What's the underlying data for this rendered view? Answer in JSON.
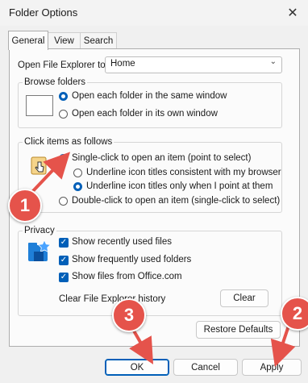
{
  "window": {
    "title": "Folder Options",
    "close_glyph": "✕"
  },
  "tabs": [
    {
      "label": "General",
      "active": true
    },
    {
      "label": "View"
    },
    {
      "label": "Search"
    }
  ],
  "open_explorer": {
    "label": "Open File Explorer to:",
    "value": "Home"
  },
  "browse_folders": {
    "legend": "Browse folders",
    "options": [
      {
        "label": "Open each folder in the same window",
        "selected": true
      },
      {
        "label": "Open each folder in its own window",
        "selected": false
      }
    ]
  },
  "click_items": {
    "legend": "Click items as follows",
    "single_click": {
      "label": "Single-click to open an item (point to select)",
      "selected": true
    },
    "underline_browser": {
      "label": "Underline icon titles consistent with my browser",
      "selected": false
    },
    "underline_point": {
      "label": "Underline icon titles only when I point at them",
      "selected": true
    },
    "double_click": {
      "label": "Double-click to open an item (single-click to select)",
      "selected": false
    }
  },
  "privacy": {
    "legend": "Privacy",
    "options": [
      {
        "label": "Show recently used files",
        "checked": true
      },
      {
        "label": "Show frequently used folders",
        "checked": true
      },
      {
        "label": "Show files from Office.com",
        "checked": true
      }
    ],
    "clear_label": "Clear File Explorer history",
    "clear_button": "Clear"
  },
  "restore_defaults": "Restore Defaults",
  "buttons": {
    "ok": "OK",
    "cancel": "Cancel",
    "apply": "Apply"
  },
  "annotations": [
    {
      "number": "1"
    },
    {
      "number": "2"
    },
    {
      "number": "3"
    }
  ],
  "colors": {
    "accent": "#005fb8",
    "annotation": "#e5534b"
  }
}
